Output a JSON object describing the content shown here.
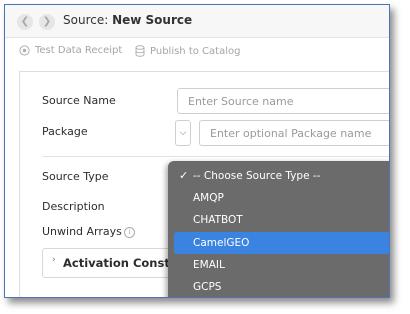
{
  "window": {
    "title_prefix": "Source:",
    "title_name": "New Source"
  },
  "toolbar": {
    "test_receipt_label": "Test Data Receipt",
    "publish_label": "Publish to Catalog"
  },
  "form": {
    "source_name_label": "Source Name",
    "source_name_placeholder": "Enter Source name",
    "package_label": "Package",
    "package_placeholder": "Enter optional Package name",
    "source_type_label": "Source Type",
    "description_label": "Description",
    "unwind_arrays_label": "Unwind Arrays",
    "activation_label": "Activation Constrai"
  },
  "source_type_dropdown": {
    "selected_index": 0,
    "highlighted_index": 3,
    "options": [
      "-- Choose Source Type --",
      "AMQP",
      "CHATBOT",
      "CamelGEO",
      "EMAIL",
      "GCPS"
    ]
  },
  "colors": {
    "accent": "#4a73b8",
    "highlight": "#3b83e0",
    "dropdown_bg": "#6b6b6b"
  }
}
